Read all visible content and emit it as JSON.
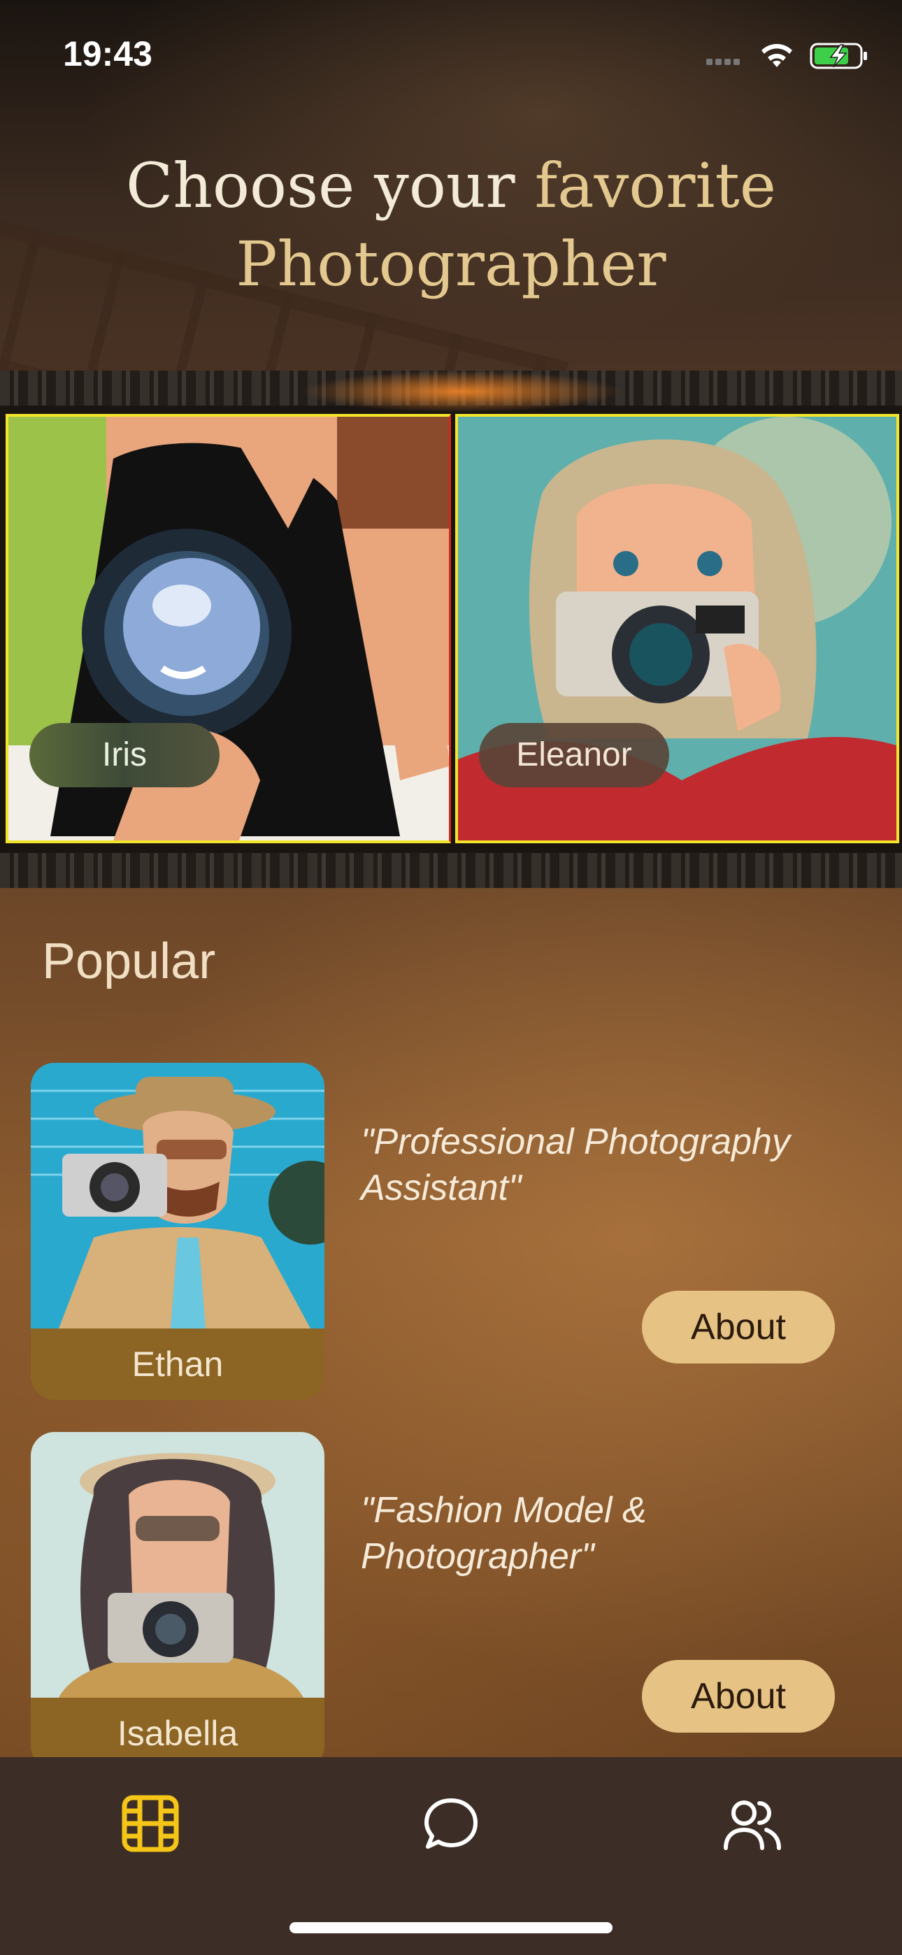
{
  "status_bar": {
    "time": "19:43"
  },
  "header": {
    "title_line1_plain": "Choose your ",
    "title_line1_accent": "favorite",
    "title_line2": "Photographer"
  },
  "featured": [
    {
      "name": "Iris"
    },
    {
      "name": "Eleanor"
    }
  ],
  "popular": {
    "title": "Popular",
    "items": [
      {
        "name": "Ethan",
        "quote": "\"Professional Photography Assistant\"",
        "button": "About"
      },
      {
        "name": "Isabella",
        "quote": "\"Fashion Model & Photographer\"",
        "button": "About"
      }
    ]
  },
  "tabbar": {
    "tabs": [
      {
        "icon": "film-icon",
        "active": true
      },
      {
        "icon": "chat-bubble-icon",
        "active": false
      },
      {
        "icon": "users-icon",
        "active": false
      }
    ]
  },
  "colors": {
    "accent_gold": "#e6c384",
    "tab_active": "#f5c518",
    "tab_inactive": "#ffffff",
    "tabbar_bg": "#3c2e27"
  }
}
